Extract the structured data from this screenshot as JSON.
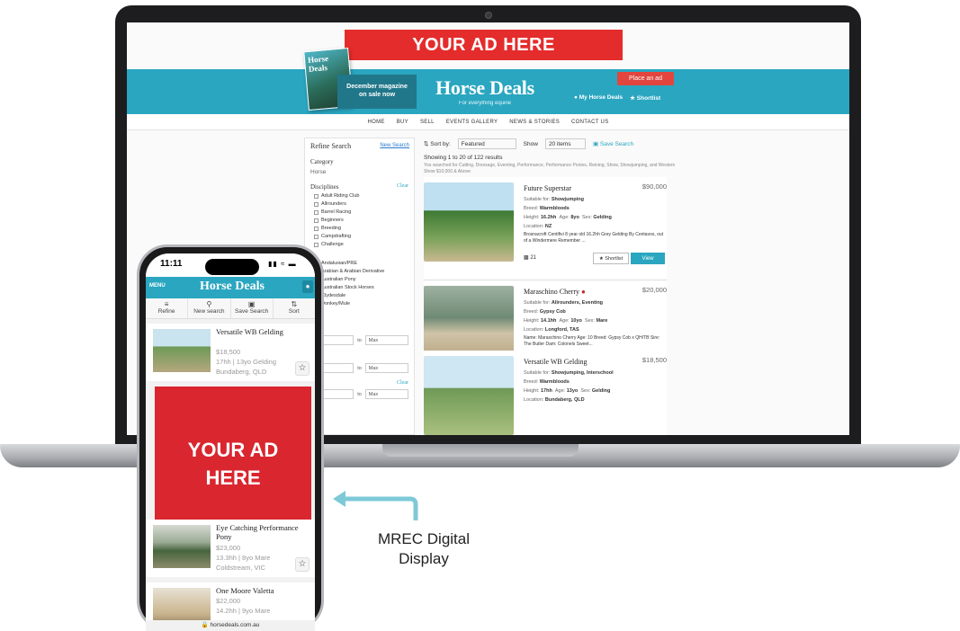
{
  "laptop_site": {
    "leaderboard_ad": "YOUR AD HERE",
    "magazine": {
      "cover_title": "Horse Deals",
      "banner_line1": "December magazine",
      "banner_line2": "on sale now"
    },
    "logo": {
      "name": "Horse Deals",
      "tagline": "For everything equine"
    },
    "place_ad_label": "Place an ad",
    "my_account_label": "My Horse Deals",
    "shortlist_label": "Shortlist",
    "nav": [
      "HOME",
      "BUY",
      "SELL",
      "EVENTS GALLERY",
      "NEWS & STORIES",
      "CONTACT US"
    ],
    "refine": {
      "title": "Refine Search",
      "new_search": "New Search",
      "category_label": "Category",
      "category_value": "Horse",
      "disciplines_label": "Disciplines",
      "clear": "Clear",
      "disciplines": [
        "Adult Riding Club",
        "Allrounders",
        "Barrel Racing",
        "Beginners",
        "Breeding",
        "Campdrafting",
        "Challenge"
      ],
      "breeds": [
        "Andalusian/PRE",
        "Arabian & Arabian Derivative",
        "Australian Pony",
        "Australian Stock Horses",
        "Clydesdale",
        "Donkey/Mule"
      ],
      "to_label": "to",
      "max_label": "Max"
    },
    "toolbar": {
      "sort_label": "Sort by:",
      "sort_value": "Featured",
      "show_label": "Show",
      "show_value": "20 items",
      "save_search": "Save Search"
    },
    "results": {
      "count": "Showing 1 to 20 of 122 results",
      "summary": "You searched for Cutting, Dressage, Eventing, Performance, Performance Ponies, Reining, Show, Showjumping, and Western Show $10,000 & Above"
    },
    "listings": [
      {
        "title": "Future Superstar",
        "price": "$90,000",
        "suitable": "Showjumping",
        "breed": "Warmbloods",
        "height": "16.2hh",
        "age": "8yo",
        "sex": "Gelding",
        "location": "NZ",
        "desc": "Brosnacroft Centifivi 8 year old 16.2hh Grey Gelding By Centavos, out of a Windermere Remember ...",
        "photos": "21"
      },
      {
        "title": "Maraschino Cherry",
        "price": "$20,000",
        "suitable": "Allrounders, Eventing",
        "breed": "Gypsy Cob",
        "height": "14.1hh",
        "age": "10yo",
        "sex": "Mare",
        "location": "Longford, TAS",
        "desc": "Name: Maraschino Cherry Age: 10 Breed: Gypsy Cob x QH/TB Sire: The Butler Dam: Colonels Sweet...",
        "photos": "14"
      },
      {
        "title": "Versatile WB Gelding",
        "price": "$18,500",
        "suitable": "Showjumping, Interschool",
        "breed": "Warmbloods",
        "height": "17hh",
        "age": "13yo",
        "sex": "Gelding",
        "location": "Bundaberg, QLD"
      }
    ],
    "labels": {
      "suitable": "Suitable for:",
      "breed": "Breed:",
      "height": "Height:",
      "age": "Age:",
      "sex": "Sex:",
      "location": "Location:",
      "shortlist_btn": "Shortlist",
      "view_btn": "View"
    }
  },
  "phone": {
    "time": "11:11",
    "menu": "MENU",
    "logo": "Horse Deals",
    "tools": [
      "Refine",
      "New search",
      "Save Search",
      "Sort"
    ],
    "listings": [
      {
        "title": "Versatile WB Gelding",
        "price": "$18,500",
        "meta": "17hh | 13yo Gelding",
        "location": "Bundaberg, QLD"
      },
      {
        "title": "Eye Catching Performance Pony",
        "price": "$23,000",
        "meta": "13.3hh | 8yo Mare",
        "location": "Coldstream, VIC"
      },
      {
        "title": "One Moore Valetta",
        "price": "$22,000",
        "meta": "14.2hh | 9yo Mare"
      }
    ],
    "ad": {
      "line1": "YOUR AD",
      "line2": "HERE"
    },
    "url": "horsedeals.com.au"
  },
  "callout": {
    "line1": "MREC Digital",
    "line2": "Display"
  },
  "colors": {
    "brand_teal": "#2aa6c0",
    "ad_red": "#e42c2c",
    "place_ad": "#e2453e"
  }
}
